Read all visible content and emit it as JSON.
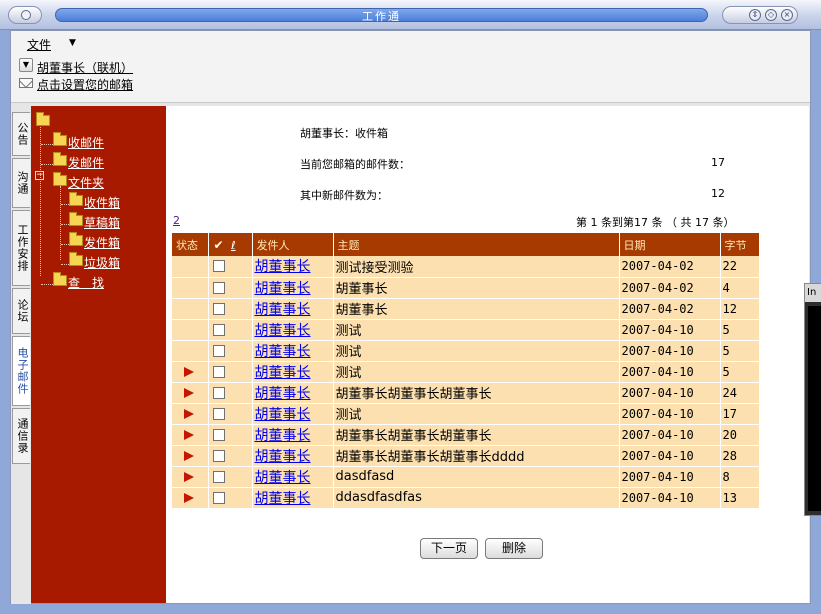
{
  "window": {
    "title": "工作通"
  },
  "menu": {
    "file_label": "文件"
  },
  "user": {
    "name": "胡董事长（联机）"
  },
  "mail_setup_label": "点击设置您的邮箱",
  "vtabs": [
    "公告",
    "沟通",
    "工作安排",
    "论坛",
    "电子邮件",
    "通信录"
  ],
  "active_tab": "电子邮件",
  "tree": {
    "inbox": "收邮件",
    "send": "发邮件",
    "folders": "文件夹",
    "folder_items": [
      "收件箱",
      "草稿箱",
      "发件箱",
      "垃圾箱"
    ],
    "search": "查　找"
  },
  "summary": {
    "mailbox_title": "胡董事长：收件箱",
    "count_label": "当前您邮箱的邮件数：",
    "count_value": "17",
    "new_label": "其中新邮件数为：",
    "new_value": "12"
  },
  "pagination": {
    "page_link": "2",
    "range_text": "第 1 条到第17 条 （ 共 17 条）"
  },
  "table": {
    "headers": {
      "status": "状态",
      "check": "✔",
      "attach": "ℓ",
      "sender": "发件人",
      "subject": "主题",
      "date": "日期",
      "size": "字节"
    },
    "rows": [
      {
        "flag": false,
        "sender": "胡董事长",
        "subject": "测试接受测验",
        "date": "2007-04-02",
        "size": "22"
      },
      {
        "flag": false,
        "sender": "胡董事长",
        "subject": "胡董事长",
        "date": "2007-04-02",
        "size": "4"
      },
      {
        "flag": false,
        "sender": "胡董事长",
        "subject": "胡董事长",
        "date": "2007-04-02",
        "size": "12"
      },
      {
        "flag": false,
        "sender": "胡董事长",
        "subject": "测试",
        "date": "2007-04-10",
        "size": "5"
      },
      {
        "flag": false,
        "sender": "胡董事长",
        "subject": "测试",
        "date": "2007-04-10",
        "size": "5"
      },
      {
        "flag": true,
        "sender": "胡董事长",
        "subject": "测试",
        "date": "2007-04-10",
        "size": "5"
      },
      {
        "flag": true,
        "sender": "胡董事长",
        "subject": "胡董事长胡董事长胡董事长",
        "date": "2007-04-10",
        "size": "24"
      },
      {
        "flag": true,
        "sender": "胡董事长",
        "subject": "测试",
        "date": "2007-04-10",
        "size": "17"
      },
      {
        "flag": true,
        "sender": "胡董事长",
        "subject": "胡董事长胡董事长胡董事长",
        "date": "2007-04-10",
        "size": "20"
      },
      {
        "flag": true,
        "sender": "胡董事长",
        "subject": "胡董事长胡董事长胡董事长dddd",
        "date": "2007-04-10",
        "size": "28"
      },
      {
        "flag": true,
        "sender": "胡董事长",
        "subject": "dasdfasd",
        "date": "2007-04-10",
        "size": "8"
      },
      {
        "flag": true,
        "sender": "胡董事长",
        "subject": "ddasdfasdfas",
        "date": "2007-04-10",
        "size": "13"
      }
    ]
  },
  "buttons": {
    "next": "下一页",
    "delete": "删除"
  },
  "side_window": {
    "title": "In"
  },
  "colors": {
    "sidebar": "#a81a00",
    "table_header": "#a63a00",
    "table_row": "#fce0b0",
    "flag": "#c41600"
  },
  "icons": {
    "flag": "red-triangle-flag-icon",
    "folder": "folder-icon",
    "mail": "envelope-icon"
  }
}
